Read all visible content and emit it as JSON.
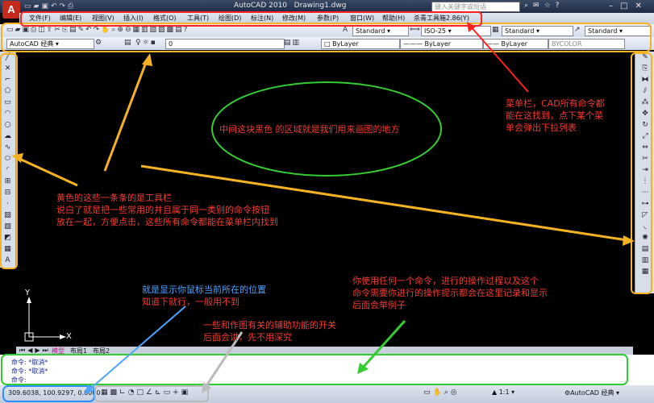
{
  "window": {
    "logo_text": "A",
    "title": "AutoCAD 2010",
    "document": "Drawing1.dwg",
    "search_placeholder": "键入关键字或短语",
    "quick_access_icons": [
      "new-icon",
      "open-icon",
      "save-icon",
      "undo-icon",
      "redo-icon",
      "print-icon"
    ],
    "controls": [
      "minimize-icon",
      "maximize-icon",
      "close-icon"
    ]
  },
  "menu": {
    "items": [
      "文件(F)",
      "编辑(E)",
      "视图(V)",
      "插入(I)",
      "格式(O)",
      "工具(T)",
      "绘图(D)",
      "标注(N)",
      "修改(M)",
      "参数(P)",
      "窗口(W)",
      "帮助(H)",
      "杀青工具箱2.86(Y)"
    ]
  },
  "toolbar": {
    "text_style": "Standard",
    "dim_style": "ISO-25",
    "table_style": "Standard",
    "multileader_style": "Standard",
    "workspace": "AutoCAD 经典",
    "layer": "0",
    "color": "ByLayer",
    "linetype": "ByLayer",
    "lineweight": "ByLayer",
    "plot_style": "BYCOLOR"
  },
  "drawing": {
    "ucs_x": "X",
    "ucs_y": "Y",
    "tabs": [
      "模型",
      "布局1",
      "布局2"
    ]
  },
  "command": {
    "lines": [
      "命令: *取消*",
      "命令: *取消*",
      "命令:"
    ]
  },
  "status": {
    "coords": "309.6038, 100.9297, 0.0000",
    "scale": "1:1",
    "workspace": "AutoCAD 经典"
  },
  "annotations": {
    "menu_note": [
      "菜单栏，CAD所有命令都",
      "能在这找到，点下某个菜",
      "单会弹出下拉列表"
    ],
    "canvas_note": "中间这块黑色 的区域就是我们用来画图的地方",
    "toolbar_note": [
      "黄色的这些一条条的是工具栏",
      "说白了就是把一些常用的并且属于同一类别的命令按钮",
      "放在一起，方便点击，这些所有命令都能在菜单栏内找到"
    ],
    "command_note": [
      "你使用任何一个命令，进行的操作过程以及这个",
      "命令需要你进行的操作提示都会在这里记录和显示",
      "后面会举例子"
    ],
    "coords_note": [
      "就是显示你鼠标当前所在的位置",
      "知道下就行，一般用不到"
    ],
    "status_note": [
      "一些和作图有关的辅助功能的开关",
      "后面会讲，先不用深究"
    ]
  },
  "colors": {
    "annotation_red": "#f23b2f",
    "annotation_blue": "#4da3ff",
    "highlight_yellow": "#f5b324",
    "highlight_green": "#33cc33",
    "highlight_red": "#ff2020"
  }
}
